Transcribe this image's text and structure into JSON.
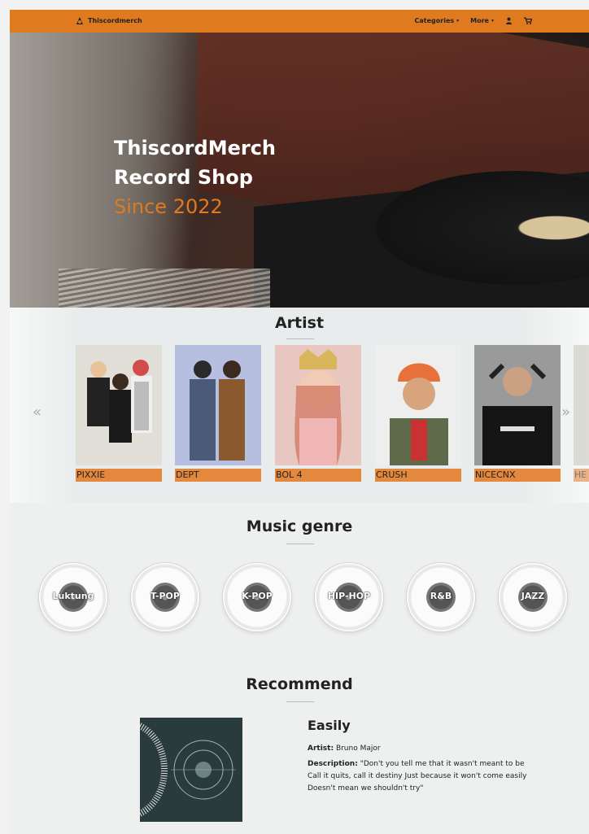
{
  "nav": {
    "brand": "Thiscordmerch",
    "categories": "Categories",
    "more": "More",
    "caret": "▾",
    "icons": [
      "user-icon",
      "cart-icon"
    ]
  },
  "hero": {
    "line1": "ThiscordMerch",
    "line2": "Record Shop",
    "line3": "Since 2022"
  },
  "artist": {
    "title": "Artist",
    "prev": "«",
    "next": "»",
    "items": [
      "PIXXIE",
      "DEPT",
      "BOL 4",
      "CRUSH",
      "NICECNX",
      "HE"
    ]
  },
  "genre": {
    "title": "Music genre",
    "items": [
      "Luktung",
      "T-POP",
      "K-POP",
      "HIP-HOP",
      "R&B",
      "JAZZ"
    ]
  },
  "recommend": {
    "title": "Recommend",
    "song": "Easily",
    "artist_label": "Artist:",
    "artist": "Bruno Major",
    "description_label": "Description:",
    "description": "\"Don't you tell me that it wasn't meant to be Call it quits, call it destiny Just because it won't come easily Doesn't mean we shouldn't try\""
  },
  "colors": {
    "accent": "#e07a1f",
    "name_bar": "#e3883d",
    "page_bg": "#edf0ef"
  }
}
